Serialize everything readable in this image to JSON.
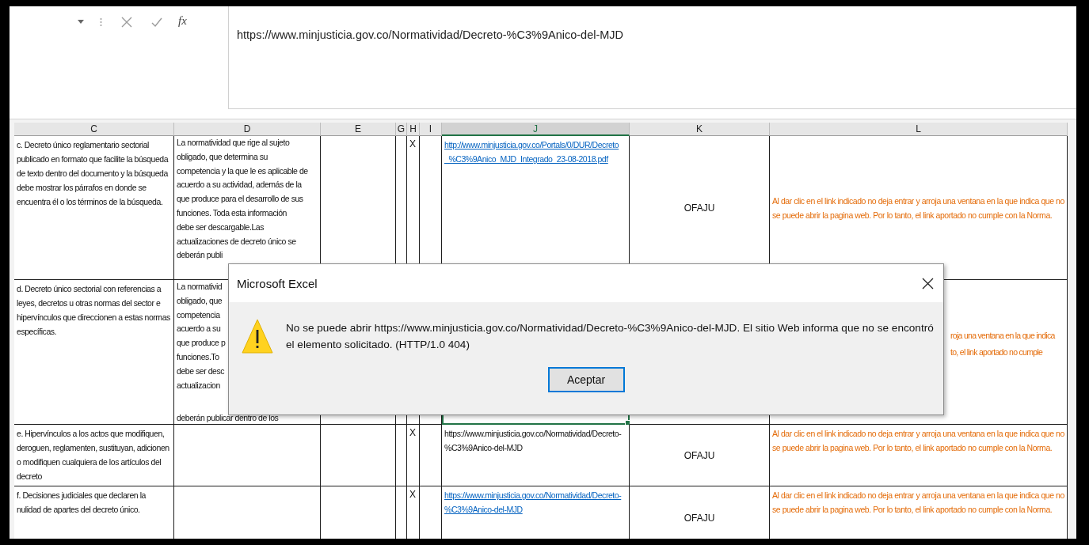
{
  "formula_bar": {
    "function_label": "fx",
    "formula": "https://www.minjusticia.gov.co/Normatividad/Decreto-%C3%9Anico-del-MJD"
  },
  "columns": [
    {
      "label": "C",
      "selected": false
    },
    {
      "label": "D",
      "selected": false
    },
    {
      "label": "E",
      "selected": false
    },
    {
      "label": "G",
      "selected": false
    },
    {
      "label": "H",
      "selected": false
    },
    {
      "label": "I",
      "selected": false
    },
    {
      "label": "J",
      "selected": true
    },
    {
      "label": "K",
      "selected": false
    },
    {
      "label": "L",
      "selected": false
    }
  ],
  "rows": [
    {
      "c": "c. Decreto único reglamentario sectorial publicado en formato que facilite la búsqueda de texto dentro del documento y la búsqueda debe mostrar los párrafos en donde se encuentra él o los términos de la búsqueda.",
      "d_lines": [
        "La normatividad que rige al sujeto",
        "obligado, que determina su",
        "competencia y la que le es aplicable de",
        "acuerdo a su actividad, además de la",
        "que produce para el desarrollo de sus",
        "funciones.  Toda esta información",
        "debe ser descargable.Las",
        "actualizaciones de decreto único se",
        "deberán publi"
      ],
      "h": "X",
      "j": {
        "text": "http://www.minjusticia.gov.co/Portals/0/DUR/Decreto_%C3%9Anico_MJD_Integrado_23-08-2018.pdf",
        "link": true,
        "selected": false
      },
      "k": "OFAJU",
      "l": "Al dar clic en el link indicado no deja entrar y arroja una ventana en la que indica que no se puede abrir la pagina web. Por lo tanto, el link aportado no cumple con la Norma."
    },
    {
      "c": "d. Decreto único sectorial con referencias a leyes, decretos u otras normas del sector e hipervínculos que direccionen a estas normas específicas.",
      "d_lines": [
        "La normativid",
        "obligado, que",
        "competencia",
        "acuerdo a su",
        "que produce p",
        "funciones.To",
        "debe ser desc",
        "actualizacion",
        "deberán publicar dentro de los"
      ],
      "j": {
        "selected": true
      },
      "l_lines": [
        "roja una ventana en la que indica",
        "to, el link aportado no cumple"
      ]
    },
    {
      "c": "e. Hipervínculos a los actos que modifiquen, deroguen, reglamenten, sustituyan, adicionen o modifiquen cualquiera de los artículos del decreto",
      "h": "X",
      "j": {
        "text": "https://www.minjusticia.gov.co/Normatividad/Decreto-%C3%9Anico-del-MJD",
        "link": false,
        "selected": false
      },
      "k": "OFAJU",
      "l": "Al dar clic en el link indicado no deja entrar y arroja una ventana en la que indica que no se puede abrir la pagina web. Por lo tanto, el link aportado no cumple con la Norma."
    },
    {
      "c": "f. Decisiones judiciales que declaren la nulidad de apartes del decreto único.",
      "h": "X",
      "j": {
        "text": "https://www.minjusticia.gov.co/Normatividad/Decreto-%C3%9Anico-del-MJD",
        "link": true,
        "selected": false
      },
      "k": "OFAJU",
      "l": "Al dar clic en el link indicado no deja entrar y arroja una ventana en la que indica que no se puede abrir la pagina web. Por lo tanto, el link aportado no cumple con la Norma."
    }
  ],
  "dialog": {
    "title": "Microsoft Excel",
    "message": "No se puede abrir https://www.minjusticia.gov.co/Normatividad/Decreto-%C3%9Anico-del-MJD. El sitio Web informa que no se encontró el elemento solicitado. (HTTP/1.0 404)",
    "button": "Aceptar"
  }
}
